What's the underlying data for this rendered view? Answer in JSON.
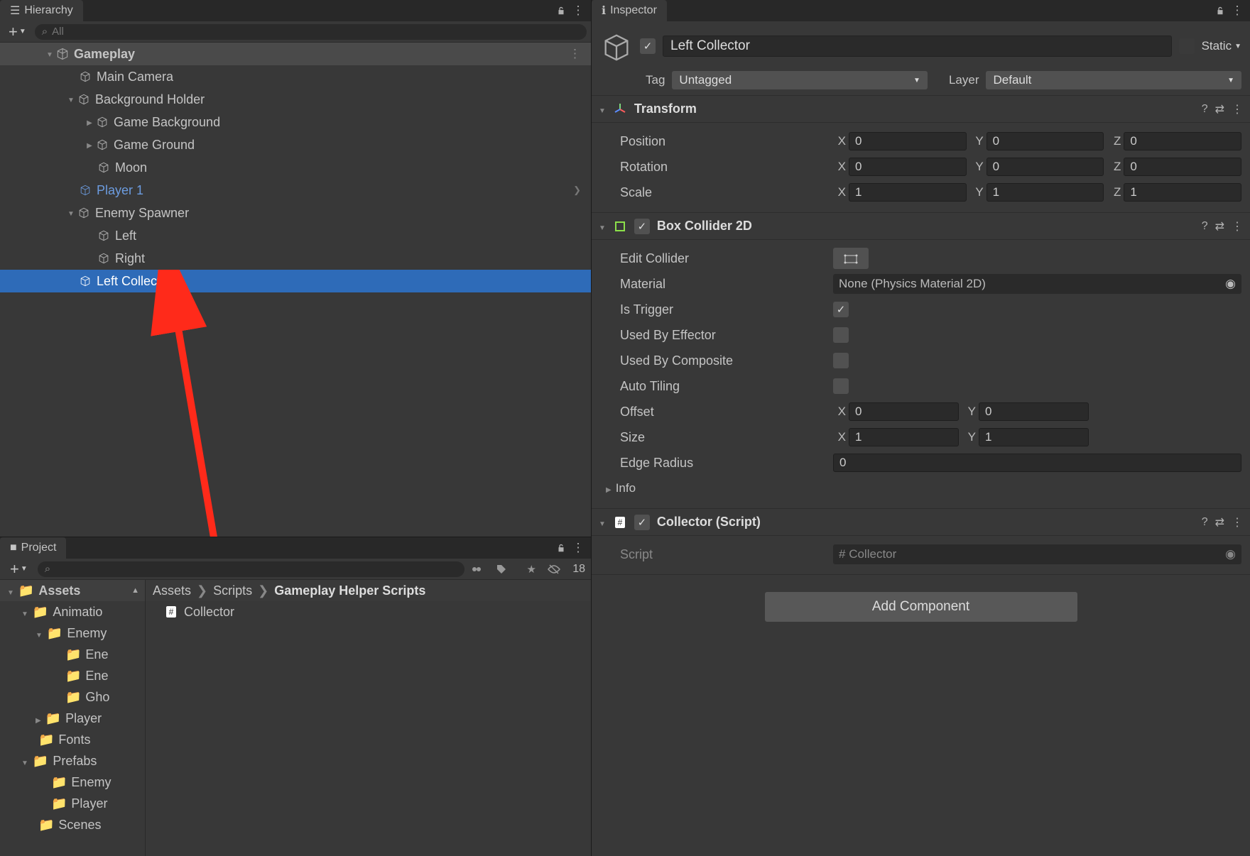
{
  "hierarchy": {
    "title": "Hierarchy",
    "search_placeholder": "All",
    "scene": "Gameplay",
    "nodes": {
      "camera": "Main Camera",
      "bgholder": "Background Holder",
      "bg": "Game Background",
      "ground": "Game Ground",
      "moon": "Moon",
      "player": "Player 1",
      "spawner": "Enemy Spawner",
      "left": "Left",
      "right": "Right",
      "leftcollector": "Left Collector"
    }
  },
  "project": {
    "title": "Project",
    "count": "18",
    "root": "Assets",
    "folders": {
      "anim": "Animatio",
      "enemy": "Enemy",
      "ene1": "Ene",
      "ene2": "Ene",
      "gho": "Gho",
      "player": "Player",
      "fonts": "Fonts",
      "prefabs": "Prefabs",
      "enemy2": "Enemy",
      "player2": "Player",
      "scenes": "Scenes"
    },
    "breadcrumb": {
      "a": "Assets",
      "b": "Scripts",
      "c": "Gameplay Helper Scripts"
    },
    "items": {
      "collector": "Collector"
    }
  },
  "inspector": {
    "title": "Inspector",
    "obj_name": "Left Collector",
    "static_label": "Static",
    "tag_label": "Tag",
    "tag_value": "Untagged",
    "layer_label": "Layer",
    "layer_value": "Default",
    "transform": {
      "title": "Transform",
      "position_label": "Position",
      "rotation_label": "Rotation",
      "scale_label": "Scale",
      "pos": {
        "x": "0",
        "y": "0",
        "z": "0"
      },
      "rot": {
        "x": "0",
        "y": "0",
        "z": "0"
      },
      "scale": {
        "x": "1",
        "y": "1",
        "z": "1"
      }
    },
    "box": {
      "title": "Box Collider 2D",
      "edit_label": "Edit Collider",
      "material_label": "Material",
      "material_value": "None (Physics Material 2D)",
      "is_trigger_label": "Is Trigger",
      "used_by_effector_label": "Used By Effector",
      "used_by_composite_label": "Used By Composite",
      "auto_tiling_label": "Auto Tiling",
      "offset_label": "Offset",
      "offset": {
        "x": "0",
        "y": "0"
      },
      "size_label": "Size",
      "size": {
        "x": "1",
        "y": "1"
      },
      "edge_radius_label": "Edge Radius",
      "edge_radius": "0",
      "info_label": "Info"
    },
    "collector": {
      "title": "Collector (Script)",
      "script_label": "Script",
      "script_value": "Collector"
    },
    "add_component": "Add Component"
  }
}
